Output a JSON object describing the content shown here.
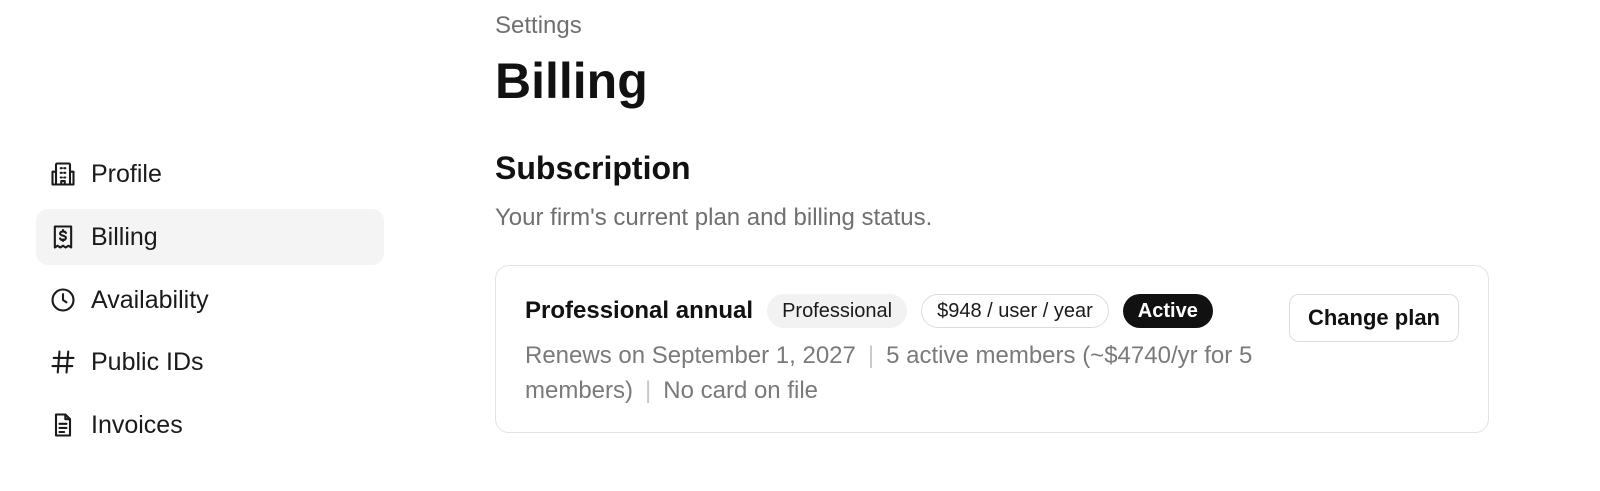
{
  "sidebar": {
    "items": [
      {
        "label": "Profile",
        "icon": "building-icon",
        "active": false
      },
      {
        "label": "Billing",
        "icon": "receipt-icon",
        "active": true
      },
      {
        "label": "Availability",
        "icon": "clock-icon",
        "active": false
      },
      {
        "label": "Public IDs",
        "icon": "hash-icon",
        "active": false
      },
      {
        "label": "Invoices",
        "icon": "document-icon",
        "active": false
      }
    ]
  },
  "header": {
    "breadcrumb": "Settings",
    "title": "Billing"
  },
  "subscription": {
    "title": "Subscription",
    "description": "Your firm's current plan and billing status.",
    "plan_name": "Professional annual",
    "tier_badge": "Professional",
    "price_badge": "$948 / user / year",
    "status_badge": "Active",
    "renewal": "Renews on September 1, 2027",
    "members": "5 active members (~$4740/yr for 5 members)",
    "card": "No card on file",
    "change_plan_label": "Change plan"
  },
  "colors": {
    "accent": "#111111",
    "muted_text": "#6f6f6f",
    "active_nav_bg": "#f4f4f4"
  }
}
